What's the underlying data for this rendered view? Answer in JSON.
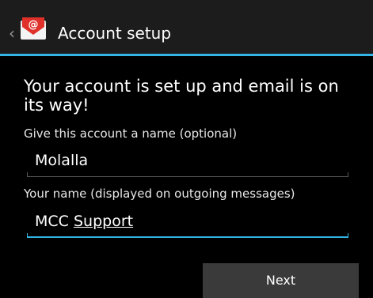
{
  "action_bar": {
    "title": "Account setup",
    "app_icon": "email-at-envelope-icon",
    "up_icon": "chevron-left-icon",
    "colors": {
      "background": "#1c1c1c",
      "divider": "#33b5e5"
    }
  },
  "content": {
    "headline": "Your account is set up and email is on its way!",
    "account_name": {
      "label": "Give this account a name (optional)",
      "value": "Molalla"
    },
    "your_name": {
      "label": "Your name (displayed on outgoing messages)",
      "value_first": "MCC",
      "value_second": "Support"
    }
  },
  "footer": {
    "next_label": "Next"
  },
  "colors": {
    "accent": "#33b5e5",
    "background": "#000000",
    "button": "#3a3a3a"
  }
}
